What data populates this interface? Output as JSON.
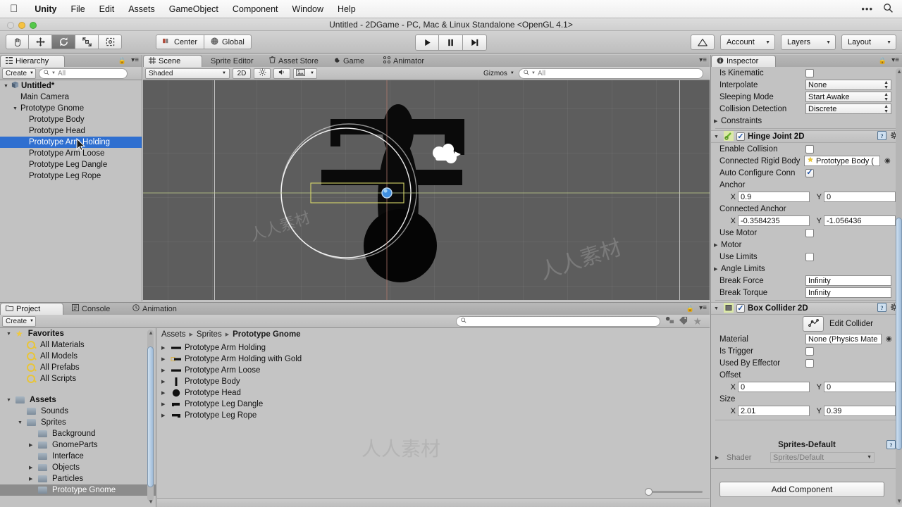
{
  "menubar": {
    "apple_icon": "apple-logo",
    "items": [
      "Unity",
      "File",
      "Edit",
      "Assets",
      "GameObject",
      "Component",
      "Window",
      "Help"
    ],
    "right_dots": "•••",
    "search_icon": "search-icon"
  },
  "window": {
    "title": "Untitled - 2DGame - PC, Mac & Linux Standalone <OpenGL 4.1>"
  },
  "toolbar": {
    "transform_tools": [
      "hand-tool",
      "move-tool",
      "rotate-tool",
      "scale-tool",
      "rect-tool"
    ],
    "active_tool_index": 2,
    "pivot_label": "Center",
    "pivot_icon": "pivot-center-icon",
    "space_label": "Global",
    "space_icon": "globe-icon",
    "play_label": "play-icon",
    "pause_label": "pause-icon",
    "step_label": "step-icon",
    "cloud_label": "cloud-icon",
    "account_label": "Account",
    "layers_label": "Layers",
    "layout_label": "Layout"
  },
  "hierarchy": {
    "tab_label": "Hierarchy",
    "tab_icon": "hierarchy-icon",
    "create_label": "Create",
    "search_placeholder": "All",
    "search_icon": "search-icon",
    "lock_icon": "lock-icon",
    "menu_icon": "panel-menu-icon",
    "scene_name": "Untitled*",
    "items": [
      {
        "label": "Main Camera",
        "depth": 1,
        "expandable": false,
        "selected": false
      },
      {
        "label": "Prototype Gnome",
        "depth": 1,
        "expandable": true,
        "selected": false
      },
      {
        "label": "Prototype Body",
        "depth": 2,
        "expandable": false,
        "selected": false
      },
      {
        "label": "Prototype Head",
        "depth": 2,
        "expandable": false,
        "selected": false
      },
      {
        "label": "Prototype Arm Holding",
        "depth": 2,
        "expandable": false,
        "selected": true
      },
      {
        "label": "Prototype Arm Loose",
        "depth": 2,
        "expandable": false,
        "selected": false
      },
      {
        "label": "Prototype Leg Dangle",
        "depth": 2,
        "expandable": false,
        "selected": false
      },
      {
        "label": "Prototype Leg Rope",
        "depth": 2,
        "expandable": false,
        "selected": false
      }
    ]
  },
  "scene": {
    "tabs": [
      {
        "label": "Scene",
        "icon": "grid-icon",
        "active": true
      },
      {
        "label": "Sprite Editor",
        "icon": "",
        "active": false
      },
      {
        "label": "Asset Store",
        "icon": "cart-icon",
        "active": false
      },
      {
        "label": "Game",
        "icon": "game-icon",
        "active": false
      },
      {
        "label": "Animator",
        "icon": "animator-icon",
        "active": false
      }
    ],
    "shading_label": "Shaded",
    "mode_2d_label": "2D",
    "light_icon": "lighting-icon",
    "audio_icon": "audio-icon",
    "fx_icon": "effects-icon",
    "gizmos_label": "Gizmos",
    "search_placeholder": "All",
    "background_color": "#5d5d5d",
    "selection_outline_color": "#d6d66a",
    "joint_anchor_color": "#3f8fe0",
    "gizmo_circle_color": "#ffffff"
  },
  "inspector": {
    "tab_label": "Inspector",
    "tab_icon": "info-icon",
    "lock_icon": "lock-icon",
    "menu_icon": "panel-menu-icon",
    "rigidbody_fields": [
      {
        "label": "Is Kinematic",
        "type": "checkbox",
        "checked": false
      },
      {
        "label": "Interpolate",
        "type": "dropdown",
        "value": "None"
      },
      {
        "label": "Sleeping Mode",
        "type": "dropdown",
        "value": "Start Awake"
      },
      {
        "label": "Collision Detection",
        "type": "dropdown",
        "value": "Discrete"
      },
      {
        "label": "Constraints",
        "type": "foldout"
      }
    ],
    "hinge_joint": {
      "title": "Hinge Joint 2D",
      "enabled": true,
      "icon": "hinge-joint-icon",
      "help_icon": "help-icon",
      "gear_icon": "gear-icon",
      "enable_collision_label": "Enable Collision",
      "enable_collision_checked": false,
      "connected_rigid_body_label": "Connected Rigid Body",
      "connected_rigid_body_value": "Prototype Body (",
      "auto_configure_label": "Auto Configure Conn",
      "auto_configure_checked": true,
      "anchor_label": "Anchor",
      "anchor_x": "0.9",
      "anchor_y": "0",
      "connected_anchor_label": "Connected Anchor",
      "connected_anchor_x": "-0.3584235",
      "connected_anchor_y": "-1.056436",
      "use_motor_label": "Use Motor",
      "use_motor_checked": false,
      "motor_label": "Motor",
      "use_limits_label": "Use Limits",
      "use_limits_checked": false,
      "angle_limits_label": "Angle Limits",
      "break_force_label": "Break Force",
      "break_force_value": "Infinity",
      "break_torque_label": "Break Torque",
      "break_torque_value": "Infinity",
      "x_label": "X",
      "y_label": "Y"
    },
    "box_collider": {
      "title": "Box Collider 2D",
      "enabled": true,
      "icon": "box-collider-icon",
      "help_icon": "help-icon",
      "gear_icon": "gear-icon",
      "edit_collider_label": "Edit Collider",
      "edit_collider_icon": "edit-collider-icon",
      "material_label": "Material",
      "material_value": "None (Physics Mate",
      "is_trigger_label": "Is Trigger",
      "is_trigger_checked": false,
      "used_by_effector_label": "Used By Effector",
      "used_by_effector_checked": false,
      "offset_label": "Offset",
      "offset_x": "0",
      "offset_y": "0",
      "size_label": "Size",
      "size_x": "2.01",
      "size_y": "0.39",
      "x_label": "X",
      "y_label": "Y"
    },
    "material_preview": {
      "name": "Sprites-Default",
      "shader_label": "Shader",
      "shader_value": "Sprites/Default",
      "help_icon": "help-icon"
    },
    "add_component_label": "Add Component"
  },
  "project": {
    "tabs": [
      {
        "label": "Project",
        "icon": "folder-icon",
        "active": true
      },
      {
        "label": "Console",
        "icon": "console-icon",
        "active": false
      },
      {
        "label": "Animation",
        "icon": "clock-icon",
        "active": false
      }
    ],
    "create_label": "Create",
    "search_placeholder": "",
    "search_icon": "search-icon",
    "filter_type_icon": "filter-type-icon",
    "filter_label_icon": "filter-label-icon",
    "favorites_icon": "star-icon",
    "lock_icon": "lock-icon",
    "menu_icon": "panel-menu-icon",
    "tree": [
      {
        "label": "Favorites",
        "depth": 0,
        "icon": "star",
        "expandable": true,
        "expanded": true,
        "bold": true
      },
      {
        "label": "All Materials",
        "depth": 1,
        "icon": "search",
        "expandable": false
      },
      {
        "label": "All Models",
        "depth": 1,
        "icon": "search",
        "expandable": false
      },
      {
        "label": "All Prefabs",
        "depth": 1,
        "icon": "search",
        "expandable": false
      },
      {
        "label": "All Scripts",
        "depth": 1,
        "icon": "search",
        "expandable": false
      },
      {
        "label": "",
        "depth": 0,
        "icon": "",
        "spacer": true
      },
      {
        "label": "Assets",
        "depth": 0,
        "icon": "folder",
        "expandable": true,
        "expanded": true,
        "bold": true
      },
      {
        "label": "Sounds",
        "depth": 1,
        "icon": "folder",
        "expandable": false
      },
      {
        "label": "Sprites",
        "depth": 1,
        "icon": "folder",
        "expandable": true,
        "expanded": true
      },
      {
        "label": "Background",
        "depth": 2,
        "icon": "folder",
        "expandable": false
      },
      {
        "label": "GnomeParts",
        "depth": 2,
        "icon": "folder",
        "expandable": true,
        "expanded": false
      },
      {
        "label": "Interface",
        "depth": 2,
        "icon": "folder",
        "expandable": false
      },
      {
        "label": "Objects",
        "depth": 2,
        "icon": "folder",
        "expandable": true,
        "expanded": false
      },
      {
        "label": "Particles",
        "depth": 2,
        "icon": "folder",
        "expandable": true,
        "expanded": false
      },
      {
        "label": "Prototype Gnome",
        "depth": 2,
        "icon": "folder",
        "expandable": false,
        "selected": true
      }
    ],
    "breadcrumb": [
      "Assets",
      "Sprites",
      "Prototype Gnome"
    ],
    "assets": [
      {
        "label": "Prototype Arm Holding",
        "icon": "sprite-bar"
      },
      {
        "label": "Prototype Arm Holding with Gold",
        "icon": "sprite-bar-gold"
      },
      {
        "label": "Prototype Arm Loose",
        "icon": "sprite-bar"
      },
      {
        "label": "Prototype Body",
        "icon": "sprite-vbar"
      },
      {
        "label": "Prototype Head",
        "icon": "sprite-circle"
      },
      {
        "label": "Prototype Leg Dangle",
        "icon": "sprite-leg"
      },
      {
        "label": "Prototype Leg Rope",
        "icon": "sprite-leg2"
      }
    ],
    "zoom_slider_value": 8
  }
}
